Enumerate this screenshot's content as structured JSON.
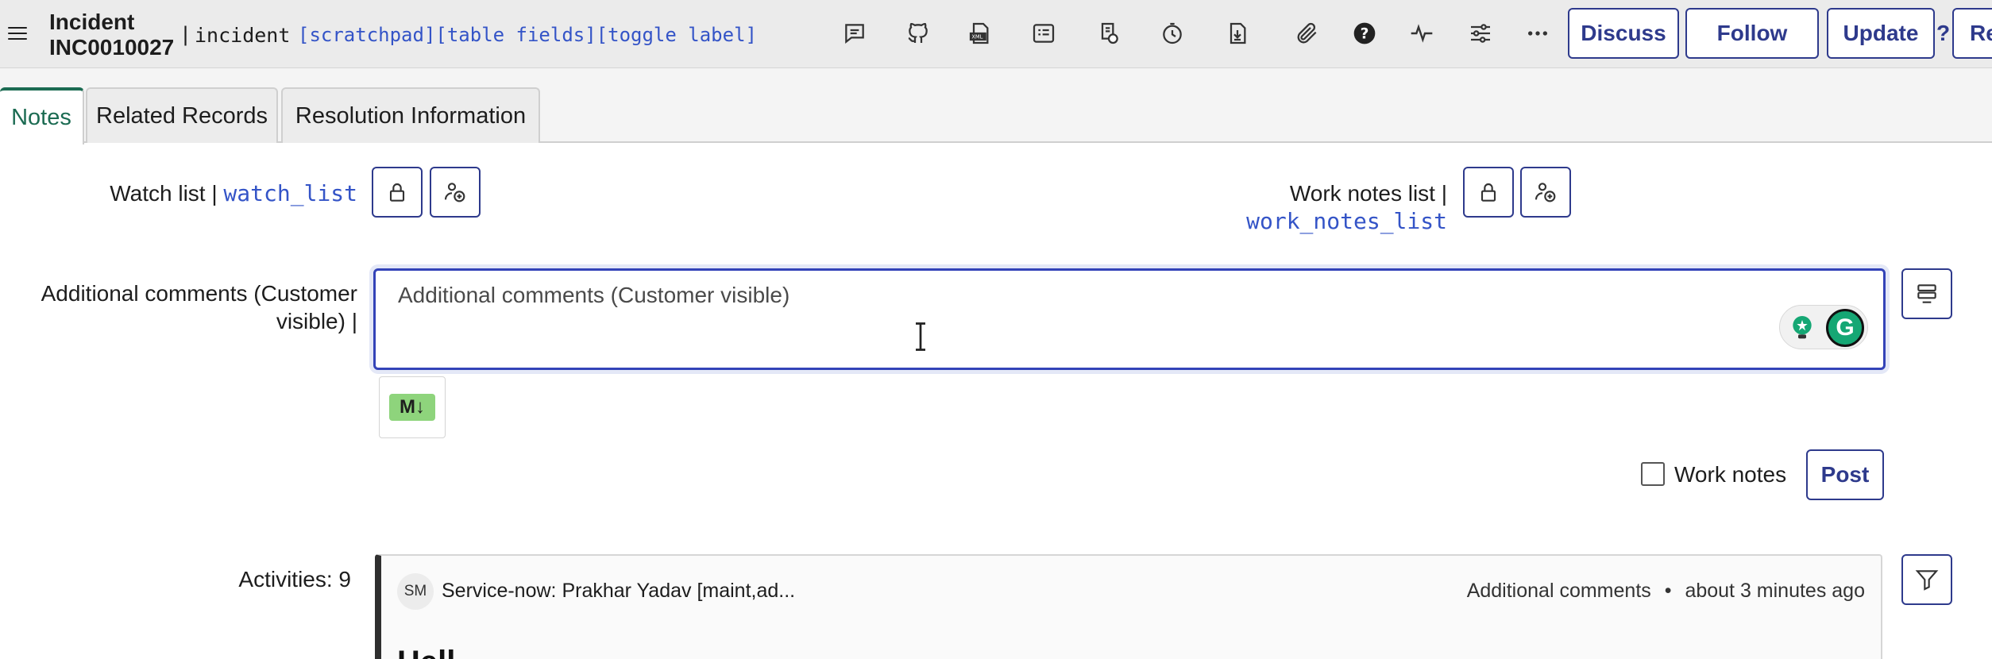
{
  "header": {
    "menu_icon": "hamburger-icon",
    "title_line1": "Incident",
    "title_line2": "INC0010027",
    "separator": "|",
    "table_name": "incident",
    "links": [
      "[scratchpad]",
      "[table fields]",
      "[toggle label]"
    ],
    "toolbar_icons": [
      "comment-icon",
      "github-icon",
      "xml-icon",
      "list-icon",
      "script-icon",
      "history-icon",
      "download-icon",
      "attachment-icon",
      "help-icon",
      "activity-pulse-icon",
      "settings-sliders-icon",
      "more-icon"
    ],
    "buttons": {
      "discuss": "Discuss",
      "follow": "Follow",
      "update": "Update",
      "question": "?",
      "partial": "Re"
    }
  },
  "tabs": [
    {
      "label": "Notes",
      "active": true
    },
    {
      "label": "Related Records",
      "active": false
    },
    {
      "label": "Resolution Information",
      "active": false
    }
  ],
  "watch_list": {
    "label": "Watch list |",
    "field": "watch_list"
  },
  "work_notes_list": {
    "label": "Work notes list |",
    "field": "work_notes_list"
  },
  "comments": {
    "label_line1": "Additional comments (Customer",
    "label_line2": "visible) |",
    "placeholder": "Additional comments (Customer visible)",
    "value": "",
    "markdown_badge": "M↓"
  },
  "work_notes_checkbox": {
    "label": "Work notes",
    "checked": false
  },
  "post_button": "Post",
  "activities": {
    "label": "Activities: 9",
    "items": [
      {
        "initials": "SM",
        "author": "Service-now: Prakhar Yadav [maint,ad...",
        "type": "Additional comments",
        "bullet": "•",
        "time": "about 3 minutes ago",
        "body_peek": "Hell"
      }
    ]
  },
  "colors": {
    "accent": "#2e3a8c",
    "link": "#3454c7",
    "active_tab": "#1b6b52",
    "grammarly": "#15a774"
  }
}
